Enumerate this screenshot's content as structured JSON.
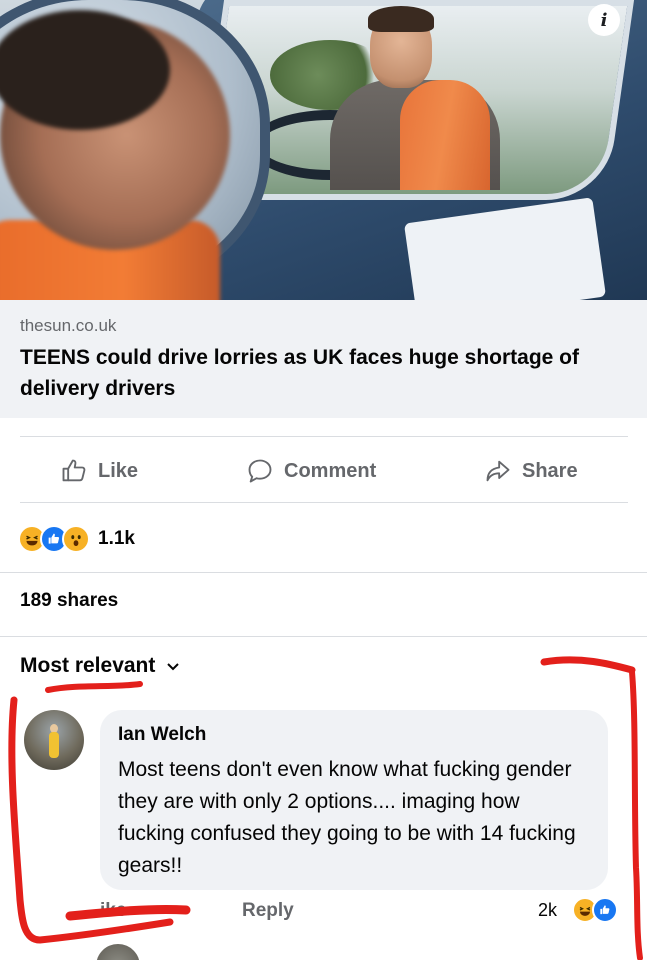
{
  "post": {
    "info_badge": "i",
    "link_domain": "thesun.co.uk",
    "link_title": "TEENS could drive lorries as UK faces huge shortage of delivery drivers"
  },
  "actions": {
    "like": "Like",
    "comment": "Comment",
    "share": "Share"
  },
  "reactions": {
    "icons": [
      "haha-icon",
      "like-icon",
      "wow-icon"
    ],
    "count": "1.1k"
  },
  "shares": "189 shares",
  "comments": {
    "sort_label": "Most relevant",
    "items": [
      {
        "author": "Ian Welch",
        "text": "Most teens don't even know what fucking gender they are with only 2 options.... imaging how fucking confused they going to be with 14 fucking gears!!",
        "like_label": "ike",
        "reply_label": "Reply",
        "reaction_count": "2k"
      }
    ]
  },
  "colors": {
    "secondary_text": "#65676b",
    "facebook_blue": "#1877f2",
    "reaction_yellow": "#f7b125",
    "annotation_red": "#e3201b",
    "card_bg": "#f0f2f5"
  }
}
